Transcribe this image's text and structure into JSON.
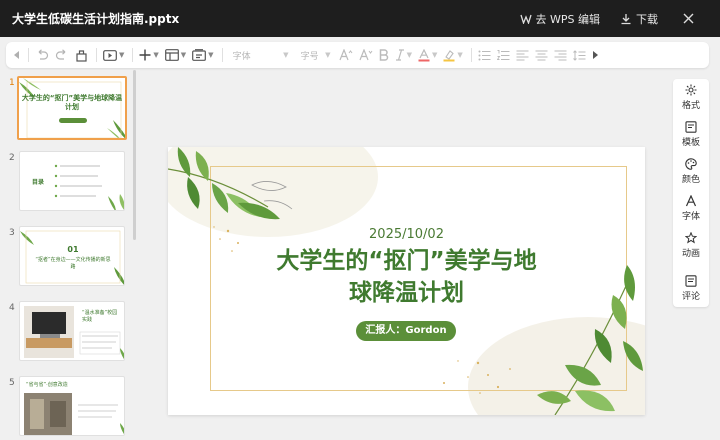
{
  "window": {
    "title": "大学生低碳生活计划指南.pptx",
    "open_in_wps_label": "去 WPS 编辑",
    "download_label": "下载"
  },
  "toolbar": {
    "font_placeholder": "字体",
    "size_placeholder": "字号"
  },
  "thumbnails": [
    {
      "number": "1",
      "title": "大学生的“抠门”美学与地球降温计划",
      "selected": true
    },
    {
      "number": "2",
      "title": "目录",
      "selected": false
    },
    {
      "number": "3",
      "section": "01",
      "title": "“抠者”在身边——文化传播的新思路",
      "selected": false
    },
    {
      "number": "4",
      "title": "“温水准备”校园实践",
      "selected": false
    },
    {
      "number": "5",
      "title": "“省与省”·创意改造",
      "selected": false
    }
  ],
  "slide": {
    "date": "2025/10/02",
    "title_line1": "大学生的“抠门”美学与地",
    "title_line2": "球降温计划",
    "reporter": "汇报人：Gordon"
  },
  "side_panel": {
    "items": [
      {
        "label": "格式",
        "icon": "format-icon"
      },
      {
        "label": "模板",
        "icon": "template-icon"
      },
      {
        "label": "颜色",
        "icon": "palette-icon"
      },
      {
        "label": "字体",
        "icon": "font-icon"
      },
      {
        "label": "动画",
        "icon": "animation-icon"
      },
      {
        "label": "评论",
        "icon": "comment-icon"
      }
    ]
  },
  "colors": {
    "title_bar": "#1e1e1e",
    "slide_green": "#3f7a2f",
    "selection_orange": "#f0a04b",
    "frame_gold": "#e6c98a"
  }
}
